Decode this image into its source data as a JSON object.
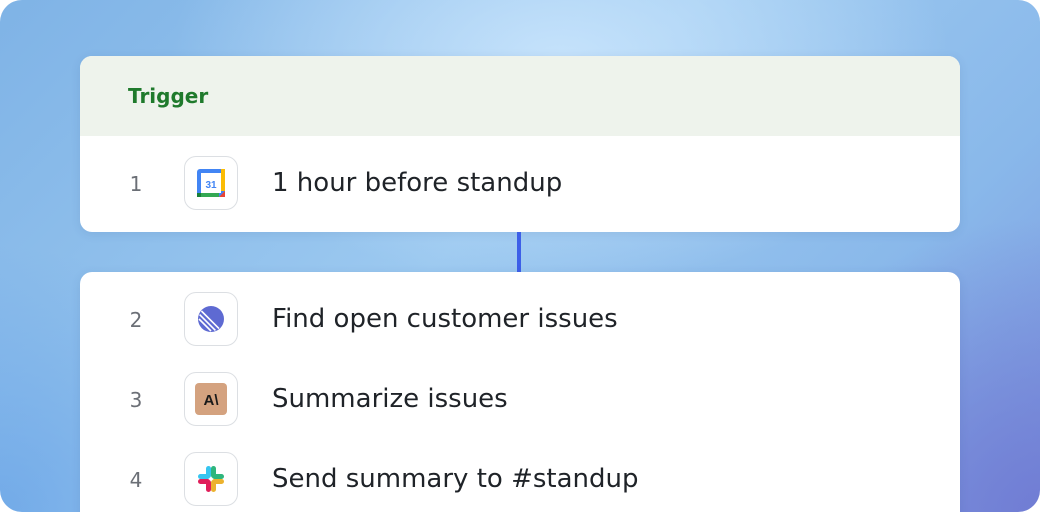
{
  "trigger": {
    "header_label": "Trigger",
    "step": {
      "number": "1",
      "label": "1 hour before standup",
      "icon": "google-calendar-icon",
      "icon_text": "31"
    }
  },
  "steps": [
    {
      "number": "2",
      "label": "Find open customer issues",
      "icon": "linear-icon"
    },
    {
      "number": "3",
      "label": "Summarize issues",
      "icon": "anthropic-icon",
      "icon_text": "A\\"
    },
    {
      "number": "4",
      "label": "Send summary to #standup",
      "icon": "slack-icon"
    }
  ],
  "colors": {
    "trigger_header_bg": "#eef3ec",
    "trigger_label": "#1f7a2c",
    "connector": "#3d5fe8"
  }
}
